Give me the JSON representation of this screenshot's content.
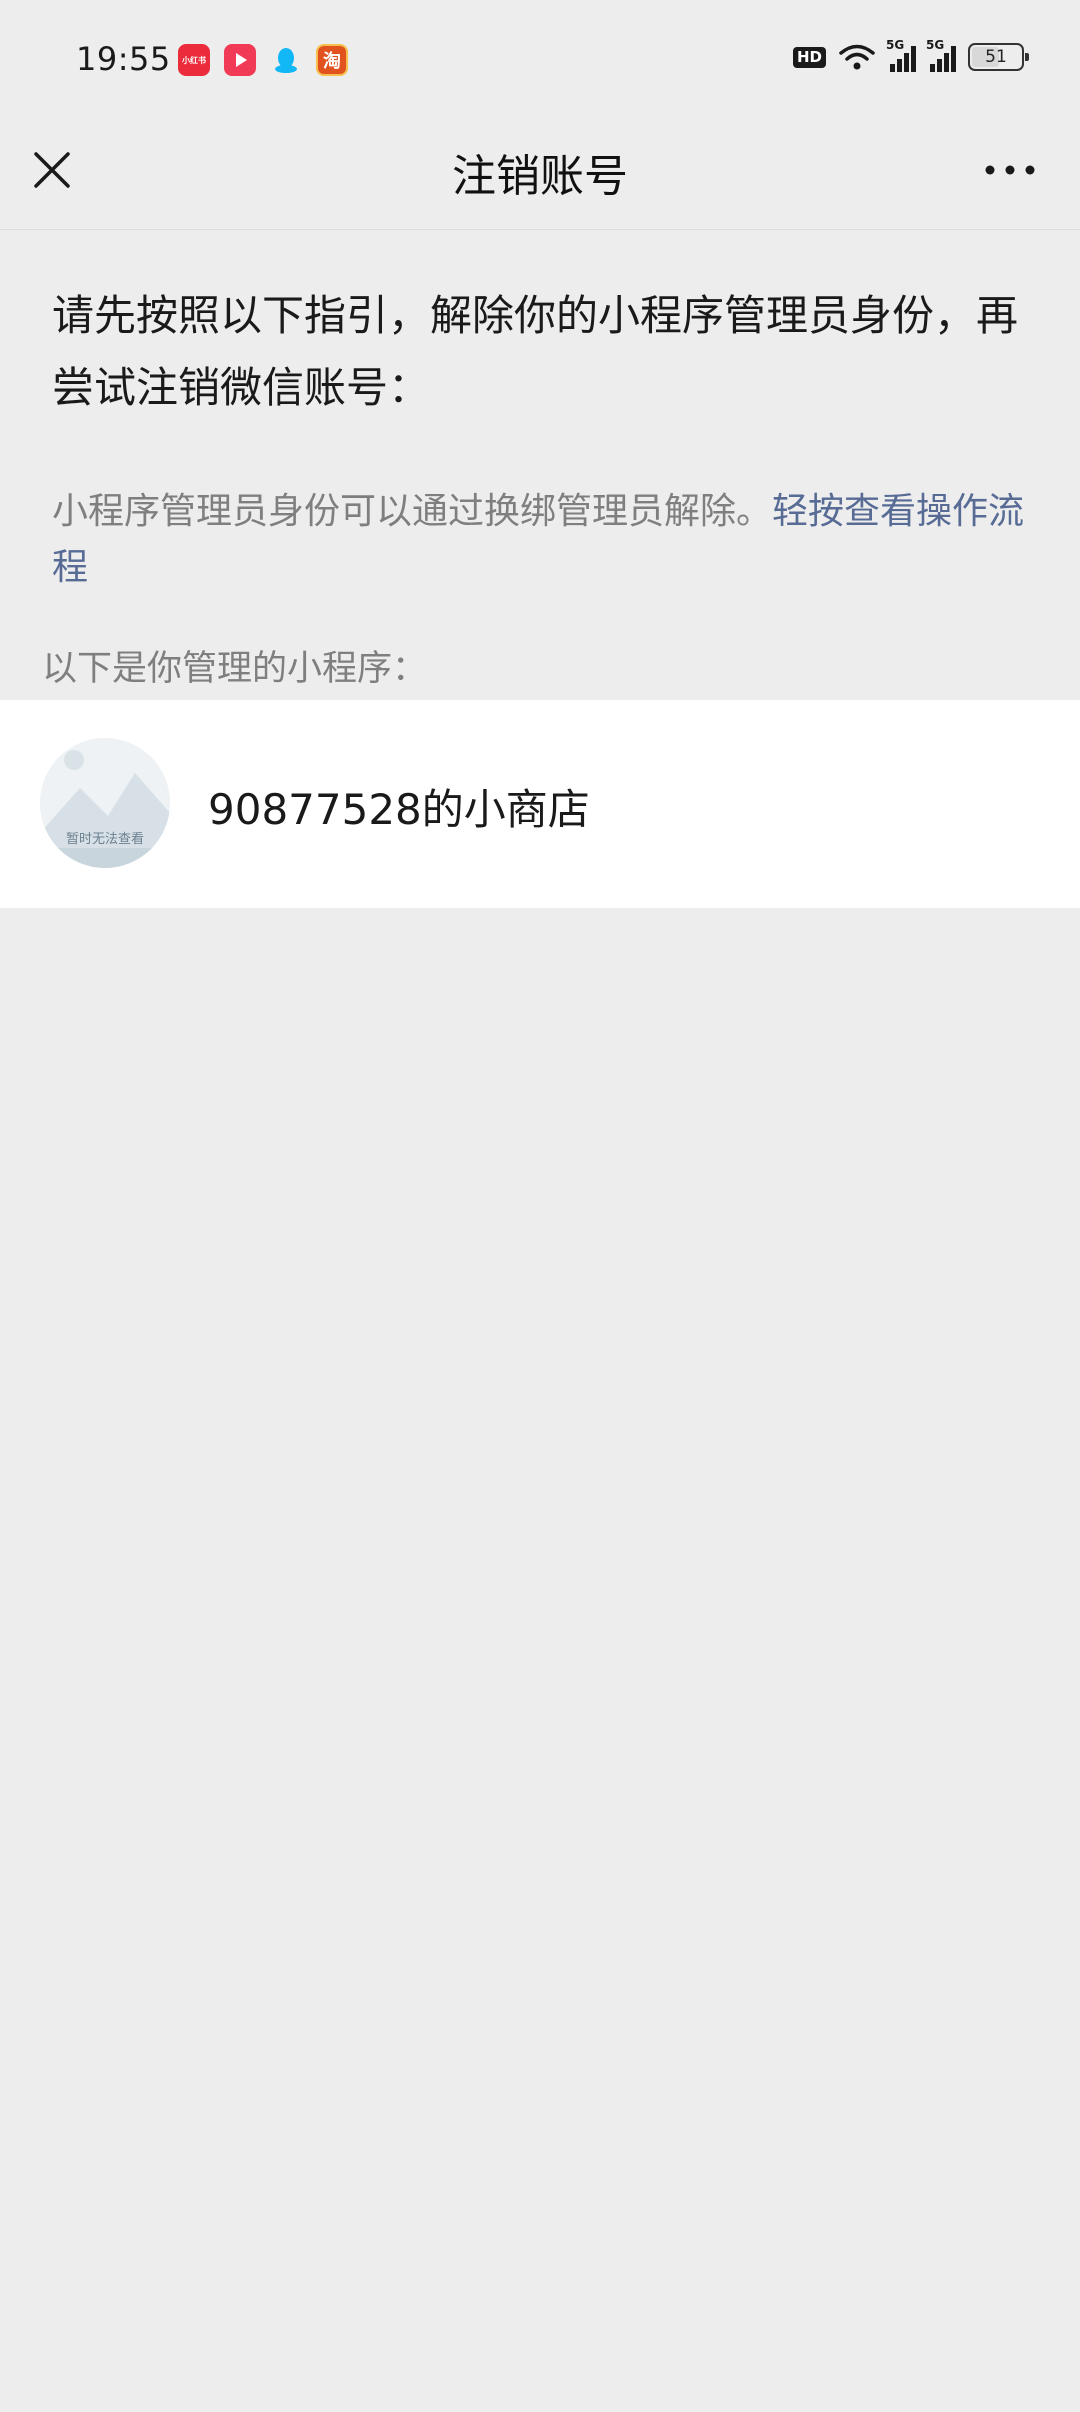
{
  "status_bar": {
    "time": "19:55",
    "app_icons": [
      "xiaohongshu-icon",
      "video-play-icon",
      "qq-penguin-icon",
      "taobao-icon"
    ],
    "redbook_label": "小红书",
    "taobao_label": "淘",
    "hd_label": "HD",
    "network_1": "5G",
    "network_2": "5G",
    "battery": "51"
  },
  "nav": {
    "title": "注销账号"
  },
  "content": {
    "intro": "请先按照以下指引，解除你的小程序管理员身份，再尝试注销微信账号：",
    "hint_text": "小程序管理员身份可以通过换绑管理员解除。",
    "hint_link": "轻按查看操作流程",
    "section_label": "以下是你管理的小程序："
  },
  "mini_programs": [
    {
      "name": "90877528的小商店",
      "avatar_text": "暂时无法查看"
    }
  ],
  "colors": {
    "background": "#ededed",
    "link": "#576b95",
    "secondary_text": "#7f7f7f"
  }
}
